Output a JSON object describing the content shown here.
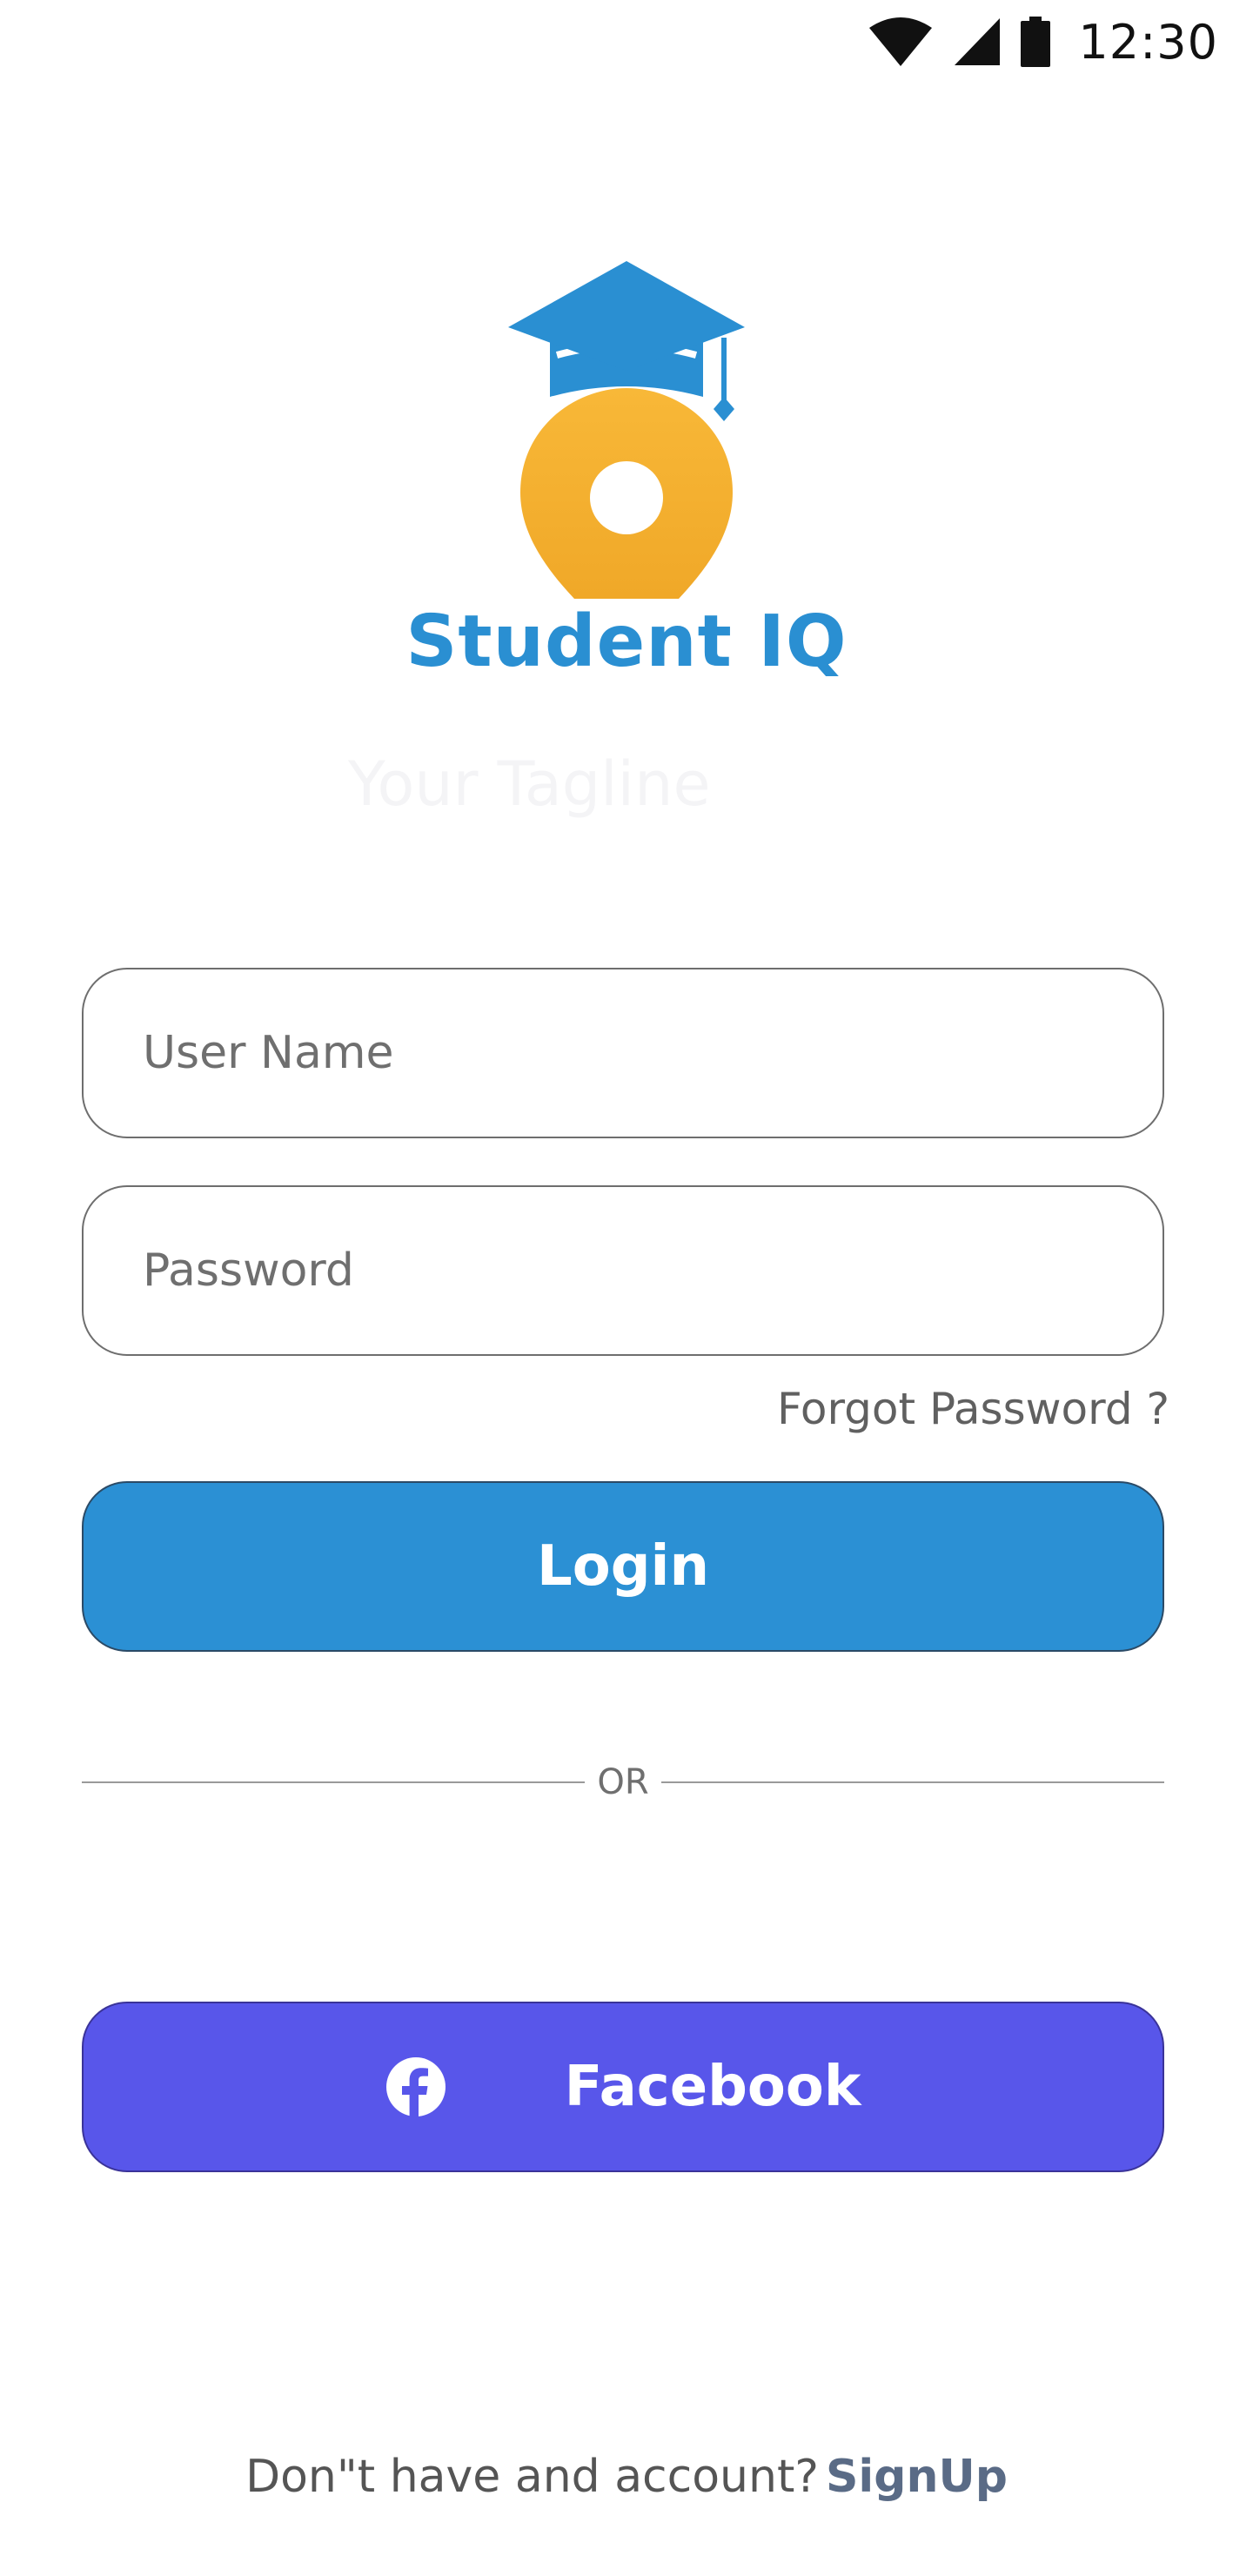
{
  "status_bar": {
    "time": "12:30",
    "icons": [
      "wifi-icon",
      "cell-signal-icon",
      "battery-icon"
    ]
  },
  "brand": {
    "name": "Student IQ",
    "tagline": "Your Tagline",
    "primary_color": "#2a8fd2",
    "accent_color": "#f6b335"
  },
  "form": {
    "username_placeholder": "User Name",
    "password_placeholder": "Password",
    "forgot_password": "Forgot Password ?",
    "login_label": "Login",
    "login_color": "#2b90d4"
  },
  "divider": {
    "label": "OR"
  },
  "social": {
    "facebook_label": "Facebook",
    "facebook_icon": "facebook-icon",
    "facebook_color": "#5856ea"
  },
  "footer": {
    "prompt": "Don\"t have and account?",
    "signup_label": "SignUp"
  }
}
